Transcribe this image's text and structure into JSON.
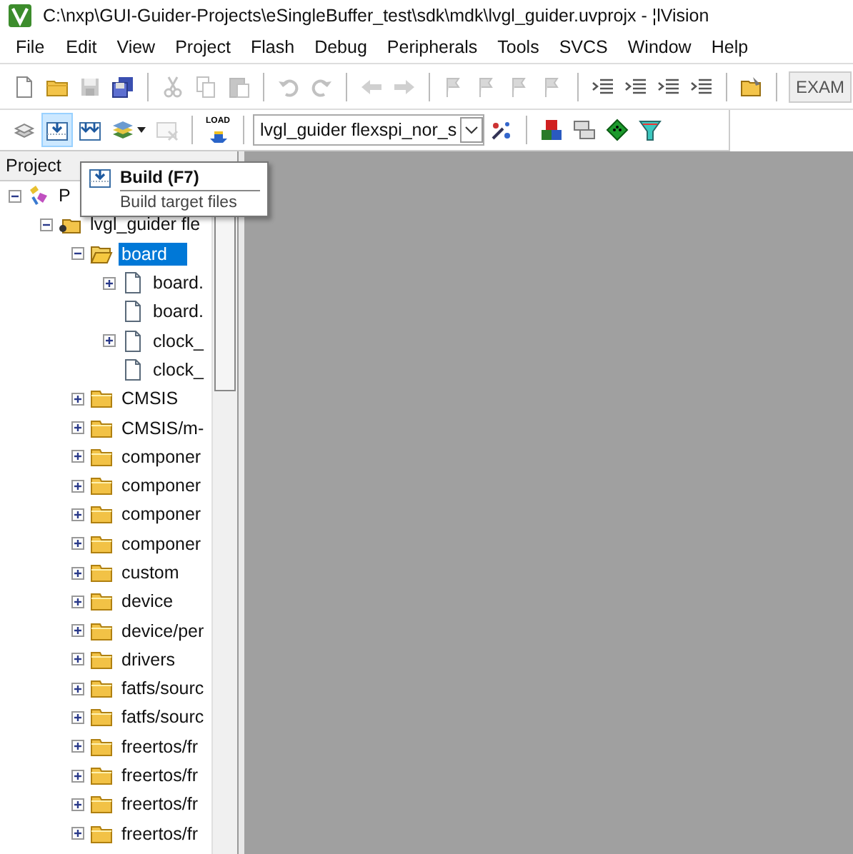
{
  "window": {
    "title": "C:\\nxp\\GUI-Guider-Projects\\eSingleBuffer_test\\sdk\\mdk\\lvgl_guider.uvprojx - ¦lVision"
  },
  "menu": [
    "File",
    "Edit",
    "View",
    "Project",
    "Flash",
    "Debug",
    "Peripherals",
    "Tools",
    "SVCS",
    "Window",
    "Help"
  ],
  "toolbar1": {
    "groups": [
      [
        {
          "disabled": false
        },
        {
          "disabled": false
        },
        {
          "disabled": true
        },
        {
          "disabled": false
        }
      ],
      [
        {
          "disabled": true
        },
        {
          "disabled": true
        },
        {
          "disabled": true
        }
      ],
      [
        {
          "disabled": true
        },
        {
          "disabled": true
        }
      ],
      [
        {
          "disabled": true
        },
        {
          "disabled": true
        }
      ],
      [
        {
          "disabled": true
        },
        {
          "disabled": true
        },
        {
          "disabled": true
        },
        {
          "disabled": true
        }
      ],
      [
        {
          "disabled": false
        },
        {
          "disabled": false
        },
        {
          "disabled": false
        },
        {
          "disabled": false
        }
      ],
      [
        {
          "disabled": false
        }
      ]
    ],
    "field": "EXAM"
  },
  "toolbar2": {
    "groups": [
      [
        {
          "disabled": false,
          "hovered": false
        },
        {
          "disabled": false,
          "hovered": true
        },
        {
          "disabled": false,
          "hovered": false
        },
        {
          "disabled": false,
          "hovered": false
        },
        {
          "disabled": true,
          "hovered": false
        }
      ],
      [
        {
          "disabled": false,
          "hovered": false,
          "label": "LOAD"
        }
      ]
    ],
    "target": "lvgl_guider flexspi_nor_s",
    "groups_after": [
      [
        {
          "disabled": false,
          "hovered": false
        }
      ],
      [
        {
          "disabled": false,
          "hovered": false
        },
        {
          "disabled": false,
          "hovered": false
        },
        {
          "disabled": false,
          "hovered": false
        },
        {
          "disabled": false,
          "hovered": false
        }
      ]
    ]
  },
  "project_panel": {
    "title": "Project",
    "tree": [
      {
        "label": "P",
        "kind": "project",
        "expandable": true,
        "expanded": true,
        "selected": false,
        "children": [
          {
            "label": "lvgl_guider fle",
            "kind": "target",
            "expandable": true,
            "expanded": true,
            "selected": false,
            "children": [
              {
                "label": "board",
                "kind": "folder",
                "expandable": true,
                "expanded": true,
                "selected": true,
                "children": [
                  {
                    "label": "board.",
                    "kind": "file",
                    "expandable": true,
                    "expanded": false,
                    "selected": false
                  },
                  {
                    "label": "board.",
                    "kind": "file",
                    "expandable": false,
                    "selected": false
                  },
                  {
                    "label": "clock_",
                    "kind": "file",
                    "expandable": true,
                    "expanded": false,
                    "selected": false
                  },
                  {
                    "label": "clock_",
                    "kind": "file",
                    "expandable": false,
                    "selected": false
                  }
                ]
              },
              {
                "label": "CMSIS",
                "kind": "folder",
                "expandable": true,
                "expanded": false,
                "selected": false
              },
              {
                "label": "CMSIS/m-",
                "kind": "folder",
                "expandable": true,
                "expanded": false,
                "selected": false
              },
              {
                "label": "componer",
                "kind": "folder",
                "expandable": true,
                "expanded": false,
                "selected": false
              },
              {
                "label": "componer",
                "kind": "folder",
                "expandable": true,
                "expanded": false,
                "selected": false
              },
              {
                "label": "componer",
                "kind": "folder",
                "expandable": true,
                "expanded": false,
                "selected": false
              },
              {
                "label": "componer",
                "kind": "folder",
                "expandable": true,
                "expanded": false,
                "selected": false
              },
              {
                "label": "custom",
                "kind": "folder",
                "expandable": true,
                "expanded": false,
                "selected": false
              },
              {
                "label": "device",
                "kind": "folder",
                "expandable": true,
                "expanded": false,
                "selected": false
              },
              {
                "label": "device/per",
                "kind": "folder",
                "expandable": true,
                "expanded": false,
                "selected": false
              },
              {
                "label": "drivers",
                "kind": "folder",
                "expandable": true,
                "expanded": false,
                "selected": false
              },
              {
                "label": "fatfs/sourc",
                "kind": "folder",
                "expandable": true,
                "expanded": false,
                "selected": false
              },
              {
                "label": "fatfs/sourc",
                "kind": "folder",
                "expandable": true,
                "expanded": false,
                "selected": false
              },
              {
                "label": "freertos/fr",
                "kind": "folder",
                "expandable": true,
                "expanded": false,
                "selected": false
              },
              {
                "label": "freertos/fr",
                "kind": "folder",
                "expandable": true,
                "expanded": false,
                "selected": false
              },
              {
                "label": "freertos/fr",
                "kind": "folder",
                "expandable": true,
                "expanded": false,
                "selected": false
              },
              {
                "label": "freertos/fr",
                "kind": "folder",
                "expandable": true,
                "expanded": false,
                "selected": false
              }
            ]
          }
        ]
      }
    ]
  },
  "tooltip": {
    "title": "Build (F7)",
    "description": "Build target files"
  }
}
